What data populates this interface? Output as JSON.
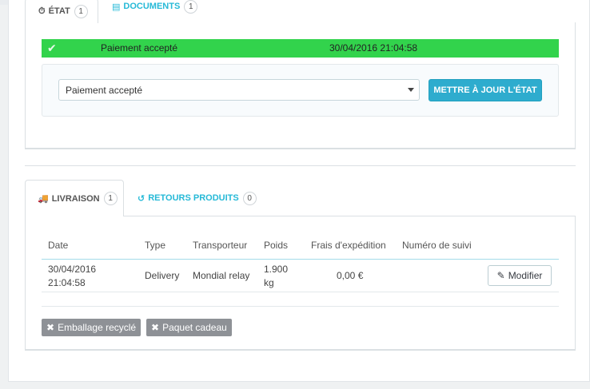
{
  "status_tabs": [
    {
      "label": "ÉTAT",
      "count": "1",
      "icon": "clock-icon",
      "active": true
    },
    {
      "label": "DOCUMENTS",
      "count": "1",
      "icon": "file-icon",
      "active": false
    }
  ],
  "status": {
    "current_label": "Paiement accepté",
    "current_date": "30/04/2016 21:04:58",
    "current_color": "#32d34c",
    "select_value": "Paiement accepté",
    "update_button": "METTRE À JOUR L'ÉTAT"
  },
  "shipping_tabs": [
    {
      "label": "LIVRAISON",
      "count": "1",
      "icon": "truck-icon",
      "active": true
    },
    {
      "label": "RETOURS PRODUITS",
      "count": "0",
      "icon": "undo-icon",
      "active": false
    }
  ],
  "shipping_table": {
    "columns": [
      "Date",
      "Type",
      "Transporteur",
      "Poids",
      "Frais d'expédition",
      "Numéro de suivi"
    ],
    "rows": [
      {
        "date_line1": "30/04/2016",
        "date_line2": "21:04:58",
        "type": "Delivery",
        "carrier": "Mondial relay",
        "weight_line1": "1.900",
        "weight_line2": "kg",
        "cost": "0,00 €",
        "tracking": "",
        "action": "Modifier"
      }
    ]
  },
  "tags": [
    {
      "label": "Emballage recyclé",
      "icon": "times-icon"
    },
    {
      "label": "Paquet cadeau",
      "icon": "times-icon"
    }
  ]
}
